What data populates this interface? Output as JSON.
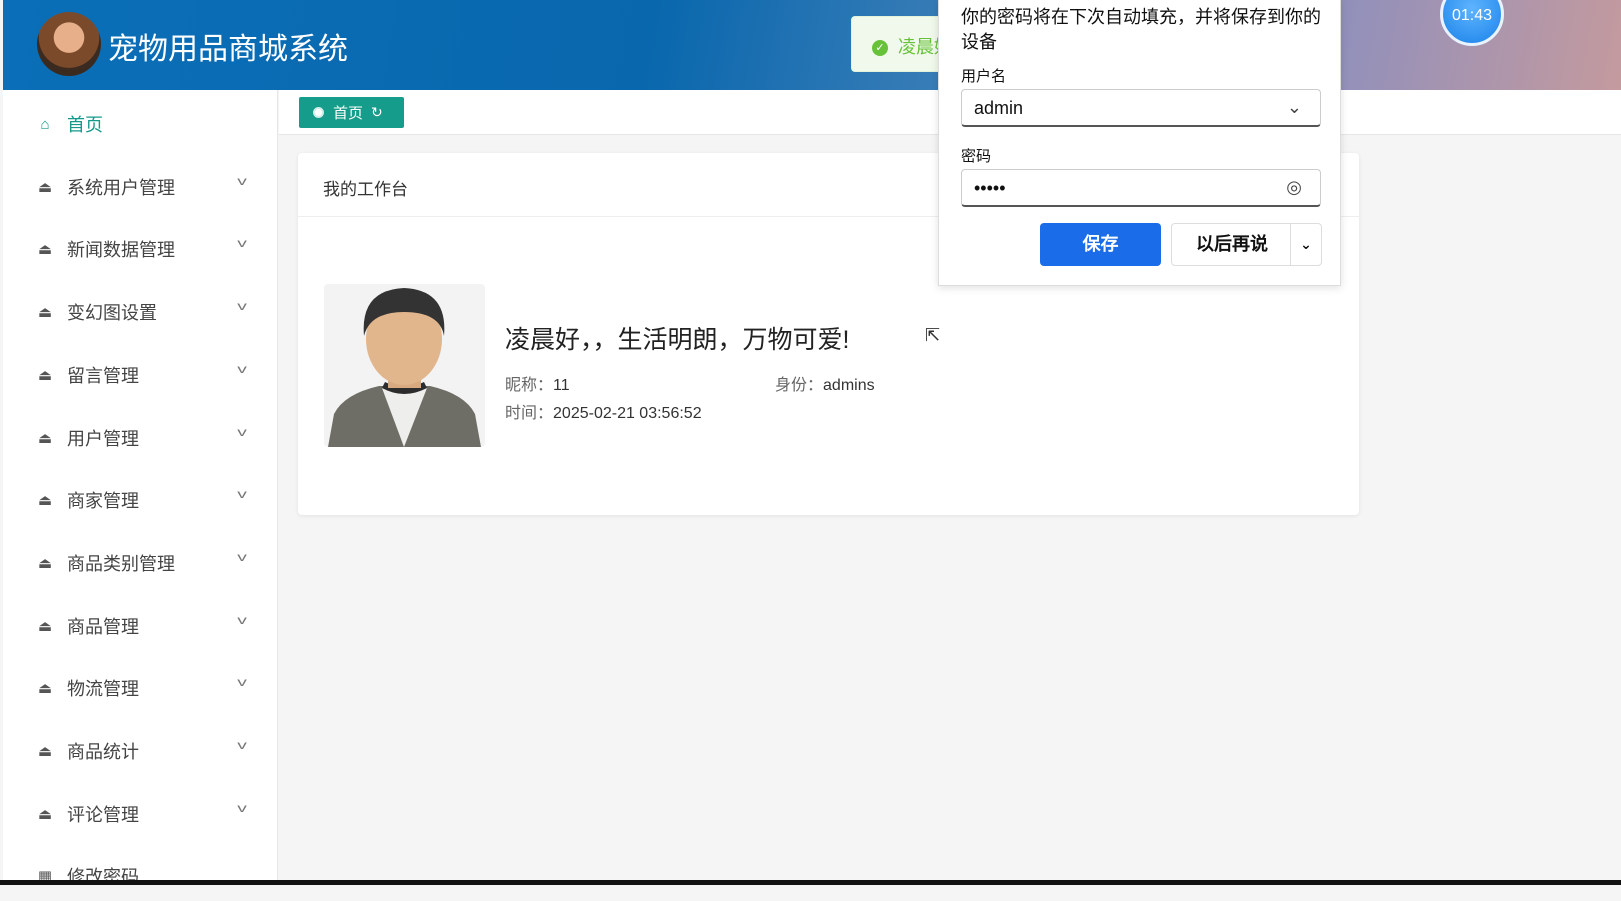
{
  "header": {
    "title": "宠物用品商城系统",
    "toast": "凌晨好",
    "timer": "01:43"
  },
  "sidebar": {
    "items": [
      {
        "label": "首页",
        "icon": "home-icon"
      },
      {
        "label": "系统用户管理",
        "icon": "bowl-icon"
      },
      {
        "label": "新闻数据管理",
        "icon": "bowl-icon"
      },
      {
        "label": "变幻图设置",
        "icon": "bowl-icon"
      },
      {
        "label": "留言管理",
        "icon": "bowl-icon"
      },
      {
        "label": "用户管理",
        "icon": "bowl-icon"
      },
      {
        "label": "商家管理",
        "icon": "bowl-icon"
      },
      {
        "label": "商品类别管理",
        "icon": "bowl-icon"
      },
      {
        "label": "商品管理",
        "icon": "bowl-icon"
      },
      {
        "label": "物流管理",
        "icon": "bowl-icon"
      },
      {
        "label": "商品统计",
        "icon": "bowl-icon"
      },
      {
        "label": "评论管理",
        "icon": "bowl-icon"
      },
      {
        "label": "修改密码",
        "icon": "grid-icon"
      }
    ]
  },
  "tabs": [
    {
      "label": "首页"
    }
  ],
  "card": {
    "title": "我的工作台",
    "greeting": "凌晨好，，生活明朗，万物可爱!",
    "nick_label": "昵称：",
    "nick": "11",
    "role_label": "身份：",
    "role": "admins",
    "time_label": "时间：",
    "time": "2025-02-21 03:56:52"
  },
  "password_popup": {
    "message": "你的密码将在下次自动填充，并将保存到你的设备",
    "username_label": "用户名",
    "username": "admin",
    "password_label": "密码",
    "password": "•••••",
    "save": "保存",
    "later": "以后再说"
  }
}
